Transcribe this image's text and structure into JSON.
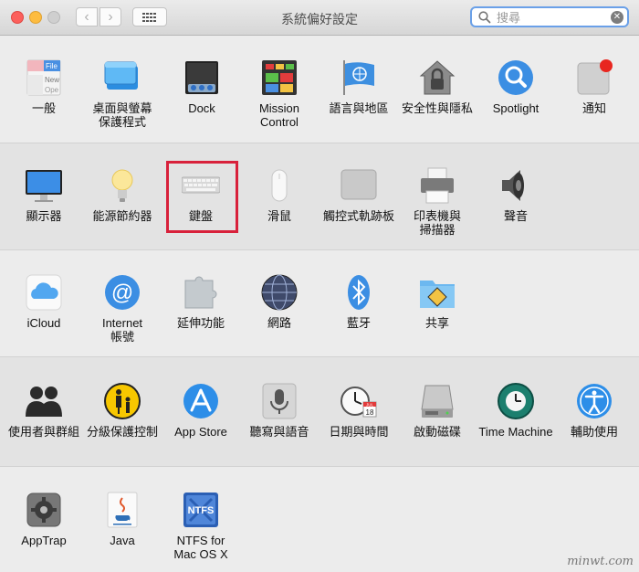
{
  "window": {
    "title": "系統偏好設定"
  },
  "toolbar": {
    "back": "‹",
    "forward": "›"
  },
  "search": {
    "placeholder": "搜尋",
    "value": ""
  },
  "sections": [
    {
      "items": [
        "一般",
        "桌面與螢幕\n保護程式",
        "Dock",
        "Mission\nControl",
        "語言與地區",
        "安全性與隱私",
        "Spotlight",
        "通知"
      ]
    },
    {
      "items": [
        "顯示器",
        "能源節約器",
        "鍵盤",
        "滑鼠",
        "觸控式軌跡板",
        "印表機與\n掃描器",
        "聲音"
      ]
    },
    {
      "items": [
        "iCloud",
        "Internet\n帳號",
        "延伸功能",
        "網路",
        "藍牙",
        "共享"
      ]
    },
    {
      "items": [
        "使用者與群組",
        "分級保護控制",
        "App Store",
        "聽寫與語音",
        "日期與時間",
        "啟動磁碟",
        "Time Machine",
        "輔助使用"
      ]
    },
    {
      "items": [
        "AppTrap",
        "Java",
        "NTFS for\nMac OS X"
      ]
    }
  ],
  "icon_text": {
    "file": "File",
    "new": "New",
    "open": "Ope",
    "calendar_month": "JUL",
    "calendar_day": "18",
    "ntfs": "NTFS"
  },
  "highlighted": "鍵盤",
  "watermark": "minwt.com",
  "colors": {
    "highlight": "#d8213b",
    "accent": "#3d8fe0"
  }
}
